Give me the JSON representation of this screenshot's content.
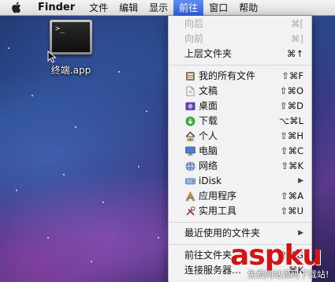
{
  "menubar": {
    "app_name": "Finder",
    "items": [
      "文件",
      "编辑",
      "显示",
      "前往",
      "窗口",
      "帮助"
    ],
    "active_item": "前往"
  },
  "desktop": {
    "icon_label": "终端.app",
    "icon_prompt": ">_"
  },
  "go_menu": {
    "items": [
      {
        "label": "向后",
        "shortcut": "⌘[",
        "disabled": true,
        "icon": ""
      },
      {
        "label": "向前",
        "shortcut": "⌘]",
        "disabled": true,
        "icon": ""
      },
      {
        "label": "上层文件夹",
        "shortcut": "⌘↑",
        "disabled": false,
        "icon": ""
      },
      {
        "label": "我的所有文件",
        "shortcut": "⇧⌘F",
        "disabled": false,
        "icon": "all-files-icon"
      },
      {
        "label": "文稿",
        "shortcut": "⇧⌘O",
        "disabled": false,
        "icon": "documents-icon"
      },
      {
        "label": "桌面",
        "shortcut": "⇧⌘D",
        "disabled": false,
        "icon": "desktop-icon"
      },
      {
        "label": "下载",
        "shortcut": "⌥⌘L",
        "disabled": false,
        "icon": "downloads-icon"
      },
      {
        "label": "个人",
        "shortcut": "⇧⌘H",
        "disabled": false,
        "icon": "home-icon"
      },
      {
        "label": "电脑",
        "shortcut": "⇧⌘C",
        "disabled": false,
        "icon": "computer-icon"
      },
      {
        "label": "网络",
        "shortcut": "⇧⌘K",
        "disabled": false,
        "icon": "network-icon"
      },
      {
        "label": "iDisk",
        "shortcut": "",
        "disabled": false,
        "icon": "idisk-icon",
        "submenu": true
      },
      {
        "label": "应用程序",
        "shortcut": "⇧⌘A",
        "disabled": false,
        "icon": "applications-icon"
      },
      {
        "label": "实用工具",
        "shortcut": "⇧⌘U",
        "disabled": false,
        "icon": "utilities-icon"
      },
      {
        "label": "最近使用的文件夹",
        "shortcut": "",
        "disabled": false,
        "icon": "",
        "submenu": true
      },
      {
        "label": "前往文件夹…",
        "shortcut": "⇧⌘G",
        "disabled": false,
        "icon": ""
      },
      {
        "label": "连接服务器…",
        "shortcut": "⌘K",
        "disabled": false,
        "icon": ""
      }
    ]
  },
  "watermark": {
    "brand": "aspku",
    "tagline": "免费网站源码下载站!"
  }
}
